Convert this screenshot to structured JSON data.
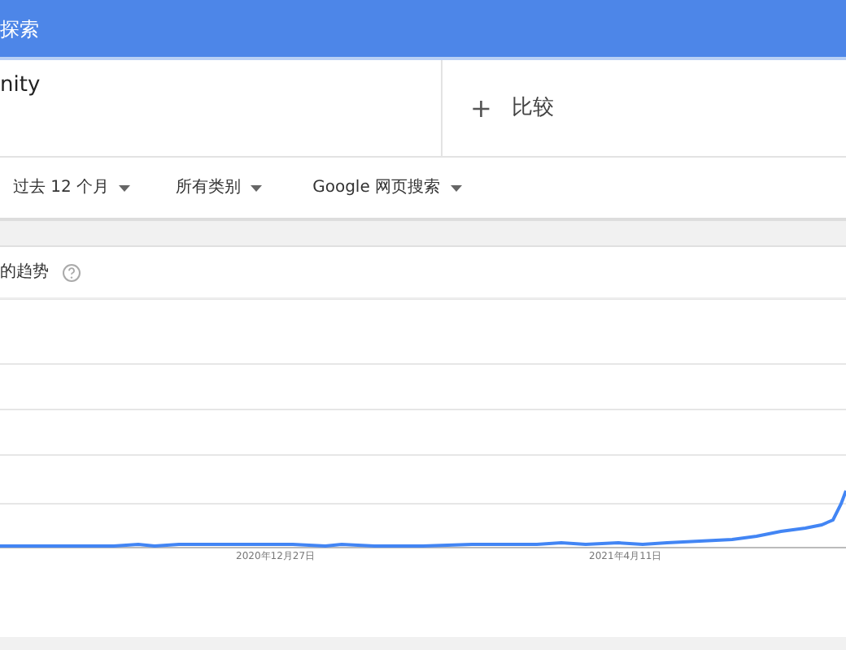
{
  "header": {
    "title": "探索"
  },
  "search_terms": [
    {
      "term": "nity"
    }
  ],
  "compare": {
    "icon": "+",
    "label": "比较"
  },
  "filters": [
    {
      "label": "过去 12 个月"
    },
    {
      "label": "所有类别"
    },
    {
      "label": "Google 网页搜索"
    }
  ],
  "card": {
    "title": "的趋势",
    "x_labels": [
      "2020年12月27日",
      "2021年4月11日"
    ]
  }
}
